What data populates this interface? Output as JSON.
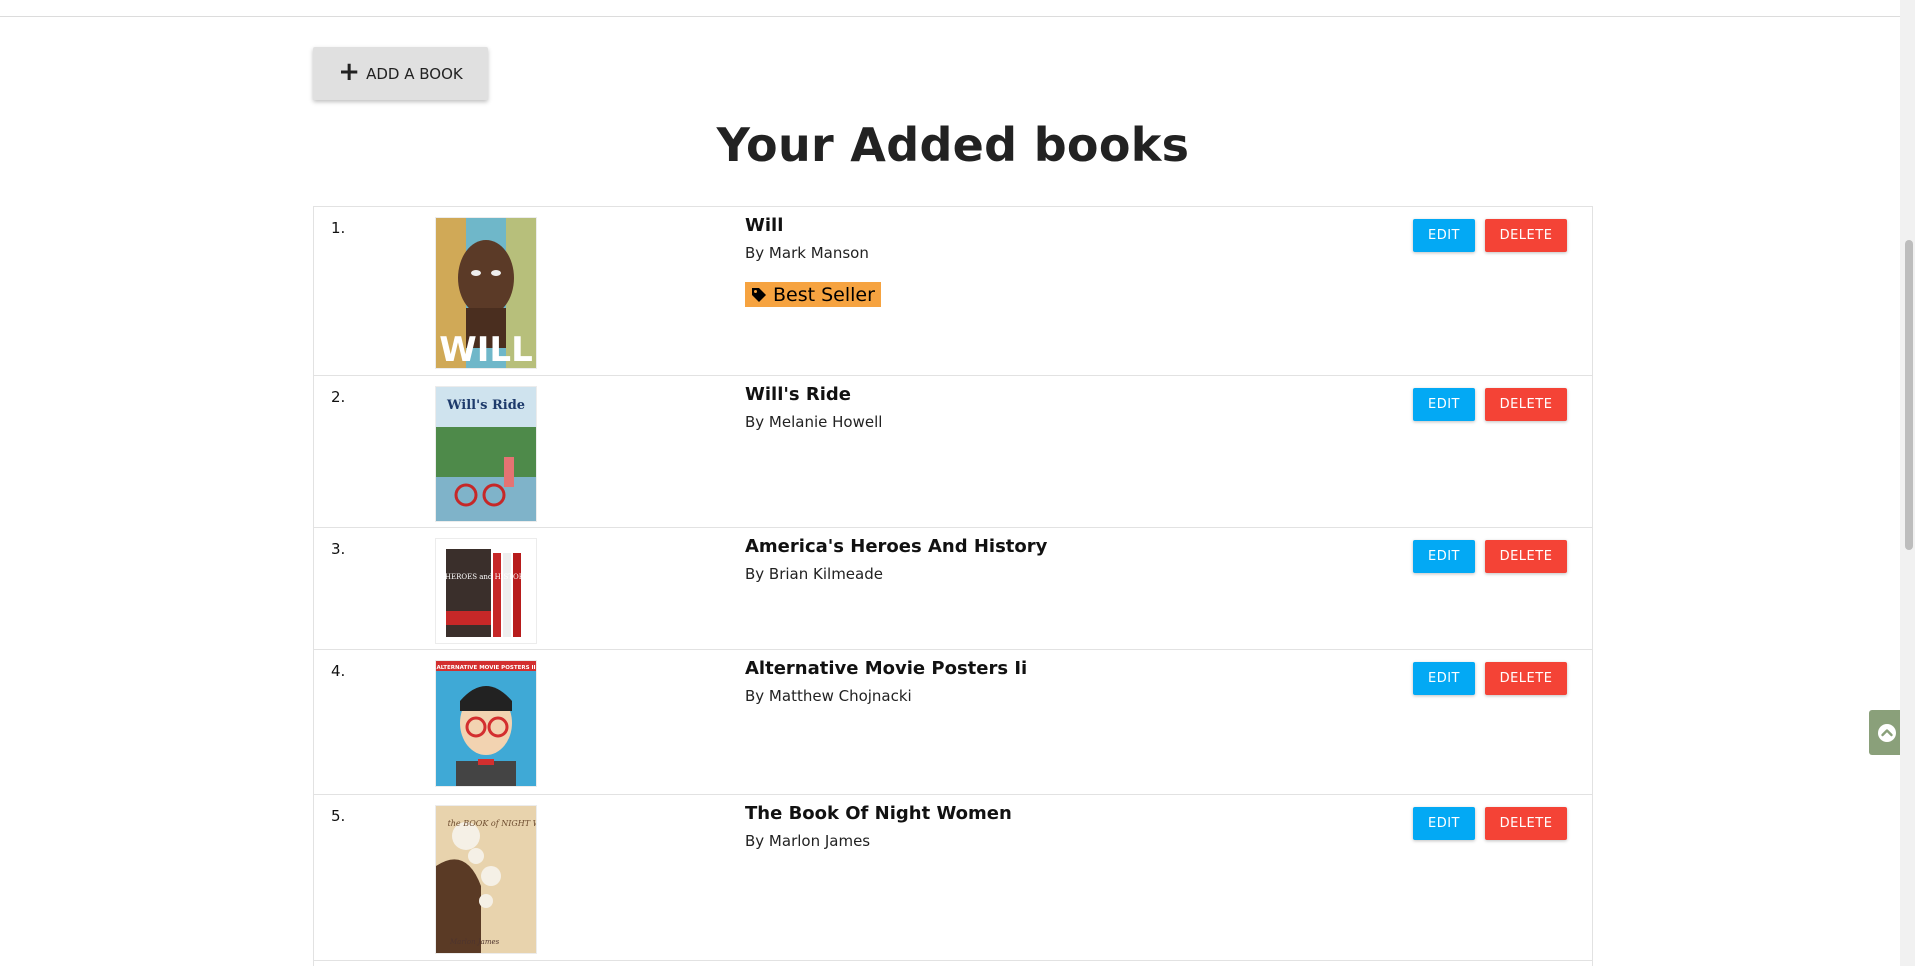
{
  "toolbar": {
    "add_label": "ADD A BOOK",
    "add_icon": "plus-icon"
  },
  "page": {
    "title": "Your Added books"
  },
  "actions": {
    "edit_label": "EDIT",
    "delete_label": "DELETE"
  },
  "books": [
    {
      "number": "1.",
      "title": "Will",
      "author": "By Mark Manson",
      "badge": "Best Seller",
      "cover_text": "WILL"
    },
    {
      "number": "2.",
      "title": "Will's Ride",
      "author": "By Melanie Howell",
      "cover_text": "Will's Ride"
    },
    {
      "number": "3.",
      "title": "America's Heroes And History",
      "author": "By Brian Kilmeade",
      "cover_text": "America's HEROES and HISTORY"
    },
    {
      "number": "4.",
      "title": "Alternative Movie Posters Ii",
      "author": "By Matthew Chojnacki",
      "cover_text": "ALTERNATIVE MOVIE POSTERS II"
    },
    {
      "number": "5.",
      "title": "The Book Of Night Women",
      "author": "By Marlon James",
      "cover_text": "the BOOK of NIGHT WOMEN",
      "cover_author": "Marlon James"
    }
  ],
  "colors": {
    "edit": "#03a9f4",
    "delete": "#f44336",
    "badge": "#f6a340"
  }
}
